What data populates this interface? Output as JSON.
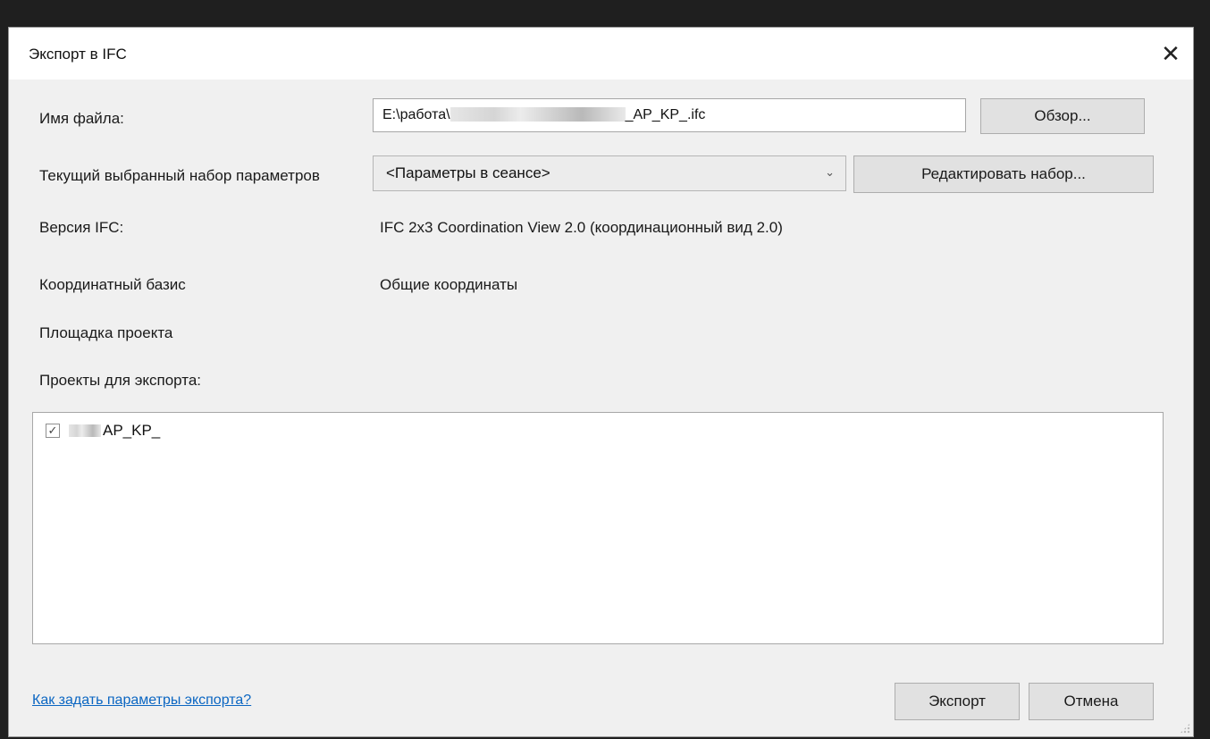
{
  "dialog": {
    "title": "Экспорт в IFC",
    "close_glyph": "✕"
  },
  "fields": {
    "filename_label": "Имя файла:",
    "filename_prefix": "E:\\работа\\",
    "filename_suffix": "_AP_KP_.ifc",
    "browse_button": "Обзор...",
    "paramset_label": "Текущий выбранный набор параметров",
    "paramset_value": "<Параметры в сеансе>",
    "edit_set_button": "Редактировать набор...",
    "ifc_version_label": "Версия IFC:",
    "ifc_version_value": "IFC 2x3 Coordination View 2.0 (координационный вид 2.0)",
    "coord_basis_label": "Координатный базис",
    "coord_basis_value": "Общие координаты",
    "site_label": "Площадка проекта",
    "projects_label": "Проекты для экспорта:"
  },
  "projects": [
    {
      "label": "AP_KP_",
      "checked": true
    }
  ],
  "footer": {
    "help_link": "Как задать параметры экспорта?",
    "export_button": "Экспорт",
    "cancel_button": "Отмена"
  },
  "icons": {
    "dropdown": "chevron-down-icon",
    "checkbox": "checkmark-icon",
    "close": "close-icon"
  }
}
